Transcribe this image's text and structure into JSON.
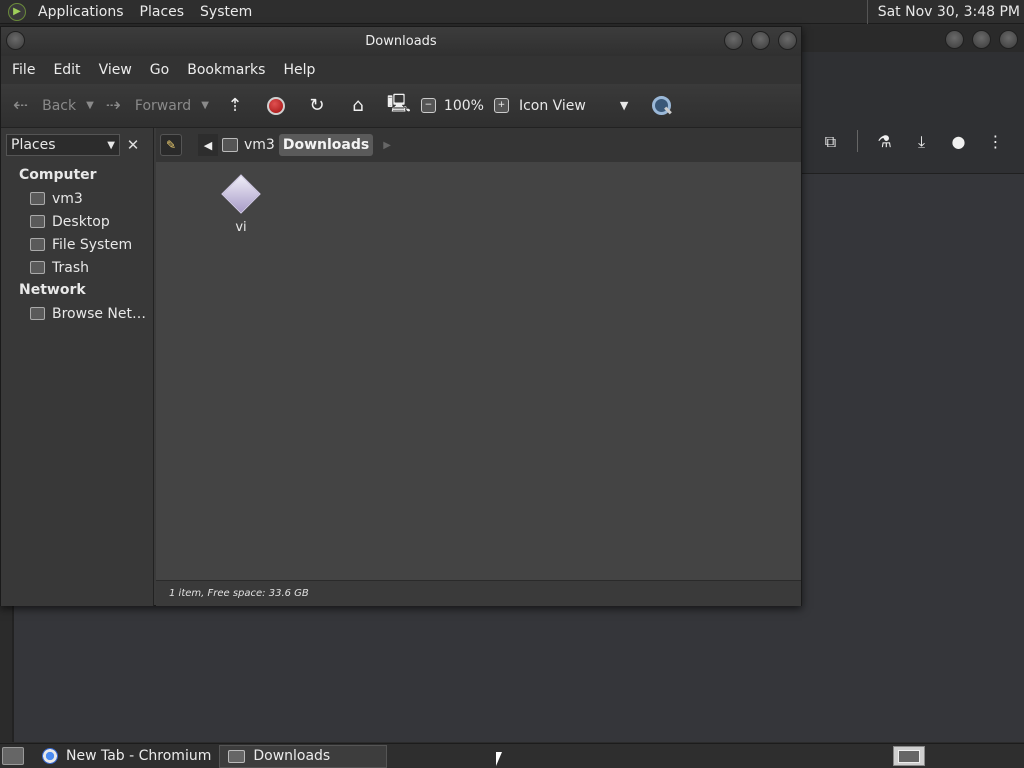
{
  "top_panel": {
    "menus": [
      "Applications",
      "Places",
      "System"
    ],
    "clock": "Sat Nov 30,  3:48 PM"
  },
  "file_manager": {
    "title": "Downloads",
    "menubar": [
      "File",
      "Edit",
      "View",
      "Go",
      "Bookmarks",
      "Help"
    ],
    "toolbar": {
      "back_label": "Back",
      "forward_label": "Forward",
      "zoom": "100%",
      "view_mode": "Icon View"
    },
    "sidebar": {
      "selector_label": "Places",
      "sections": [
        {
          "title": "Computer",
          "items": [
            "vm3",
            "Desktop",
            "File System",
            "Trash"
          ]
        },
        {
          "title": "Network",
          "items": [
            "Browse Net…"
          ]
        }
      ]
    },
    "path": {
      "segments": [
        "vm3",
        "Downloads"
      ]
    },
    "files": [
      {
        "name": "vi"
      }
    ],
    "status": "1 item, Free space: 33.6 GB"
  },
  "taskbar": {
    "tasks": [
      "New Tab - Chromium",
      "Downloads"
    ]
  },
  "colors": {
    "panel_bg": "#2e2e2e",
    "window_bg": "#3b3b3b",
    "content_bg": "#444444"
  }
}
